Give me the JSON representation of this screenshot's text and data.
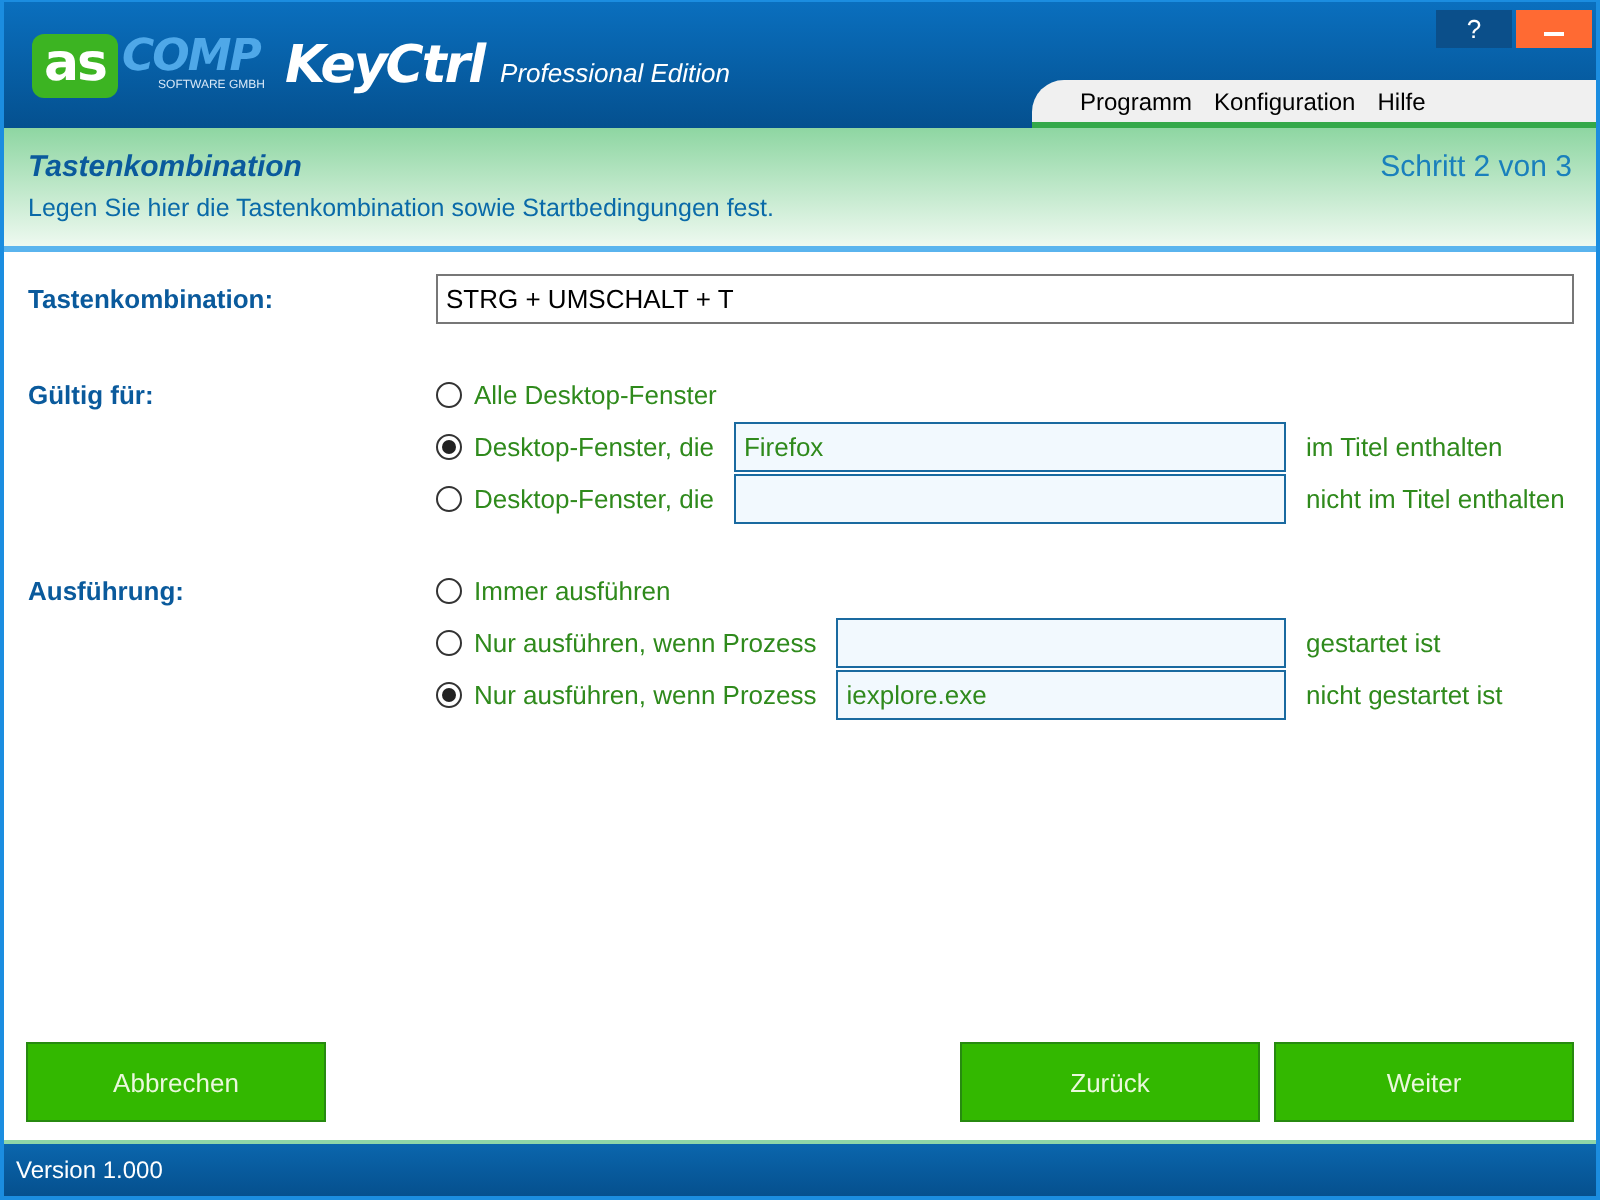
{
  "header": {
    "logo_mark": "as",
    "logo_word": "COMP",
    "logo_tagline": "SOFTWARE GMBH",
    "product": "KeyCtrl",
    "edition": "Professional Edition",
    "help_button": "?"
  },
  "menu": [
    {
      "label": "Programm"
    },
    {
      "label": "Konfiguration"
    },
    {
      "label": "Hilfe"
    }
  ],
  "banner": {
    "title": "Tastenkombination",
    "subtitle": "Legen Sie hier die Tastenkombination sowie Startbedingungen fest.",
    "step": "Schritt 2 von 3"
  },
  "hotkey": {
    "label": "Tastenkombination:",
    "value": "STRG + UMSCHALT + T"
  },
  "groups": [
    {
      "label": "Gültig für:",
      "options": [
        {
          "kind": "plain",
          "label": "Alle Desktop-Fenster",
          "selected": false
        },
        {
          "kind": "field",
          "label": "Desktop-Fenster, die",
          "selected": true,
          "value": "Firefox",
          "suffix": "im Titel enthalten"
        },
        {
          "kind": "field",
          "label": "Desktop-Fenster, die",
          "selected": false,
          "suffix": "nicht im Titel enthalten"
        }
      ]
    },
    {
      "label": "Ausführung:",
      "options": [
        {
          "kind": "plain",
          "label": "Immer ausführen",
          "selected": false
        },
        {
          "kind": "field",
          "label": "Nur ausführen, wenn Prozess",
          "selected": false,
          "suffix": "gestartet ist"
        },
        {
          "kind": "field",
          "label": "Nur ausführen, wenn Prozess",
          "selected": true,
          "value": "iexplore.exe",
          "suffix": "nicht gestartet ist"
        }
      ]
    }
  ],
  "buttons": {
    "left": [
      {
        "label": "Abbrechen"
      }
    ],
    "right": [
      {
        "label": "Zurück"
      },
      {
        "label": "Weiter"
      }
    ]
  },
  "status_bar": {
    "text": "Version 1.000"
  }
}
